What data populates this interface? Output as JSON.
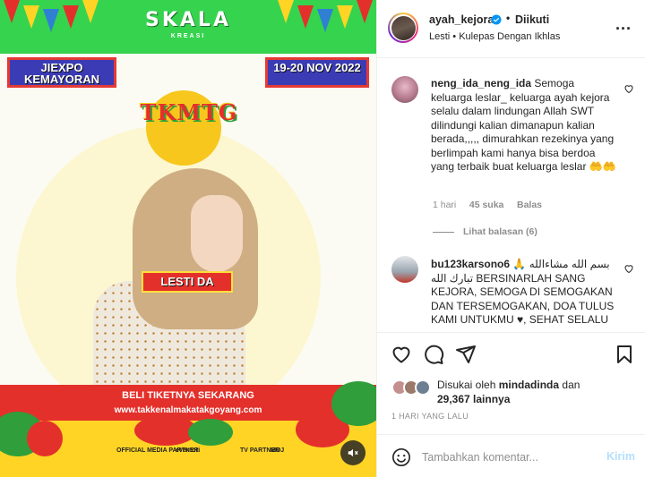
{
  "post_media": {
    "brand": "SKALA",
    "brand_sub": "KREASI",
    "venue": "JIEXPO KEMAYORAN",
    "date": "19-20 NOV 2022",
    "event_logo": "TKMTG",
    "performer": "LESTI DA",
    "ticket_cta": "BELI TIKETNYA SEKARANG",
    "ticket_url": "www.takkenalmakatakgoyang.com",
    "partners": [
      "OFFICIAL MEDIA PARTNER",
      "eventori",
      "TV PARTNER",
      "MOJ"
    ],
    "mute_icon": "speaker-muted-icon"
  },
  "header": {
    "username": "ayah_kejora",
    "verified_icon": "verified-badge-icon",
    "separator": "•",
    "follow_status": "Diikuti",
    "subtitle": "Lesti • Kulepas Dengan Ikhlas",
    "more_icon": "more-options-icon",
    "more_label": "···"
  },
  "comments": [
    {
      "username": "neng_ida_neng_ida",
      "text": "Semoga keluarga leslar_ keluarga ayah kejora selalu dalam lindungan Allah SWT dilindungi kalian dimanapun kalian berada,,,,, dimurahkan rezekinya yang berlimpah kami hanya bisa berdoa yang terbaik buat keluarga leslar",
      "emoji": "🤲🤲",
      "time": "1 hari",
      "likes": "45 suka",
      "reply": "Balas",
      "view_replies": "Lihat balasan (6)"
    },
    {
      "username": "bu123karsono6",
      "text_line1": "بسم الله مشاءالله",
      "text_line2": "🙏 تبارك الله BERSINARLAH SANG KEJORA, SEMOGA DI SEMOGAKAN DAN TERSEMOGAKAN, DOA TULUS KAMI UNTUKMU ♥, SEHAT SELALU"
    }
  ],
  "actions": {
    "like_icon": "heart-icon",
    "comment_icon": "comment-icon",
    "share_icon": "share-icon",
    "save_icon": "bookmark-icon",
    "liked_by_prefix": "Disukai oleh",
    "liked_by_user": "mindadinda",
    "liked_by_and": "dan",
    "others_count": "29,367",
    "others_label": "lainnya",
    "timestamp": "1 HARI YANG LALU"
  },
  "add_comment": {
    "emoji_icon": "emoji-icon",
    "placeholder": "Tambahkan komentar...",
    "send_label": "Kirim"
  },
  "colors": {
    "accent_blue": "#0095f6",
    "send_disabled": "#b2dffc",
    "muted_text": "#8e8e8e",
    "event_red": "#e4302b",
    "event_green": "#35d34e",
    "event_yellow": "#ffd425",
    "event_blue": "#3b3bb5"
  }
}
